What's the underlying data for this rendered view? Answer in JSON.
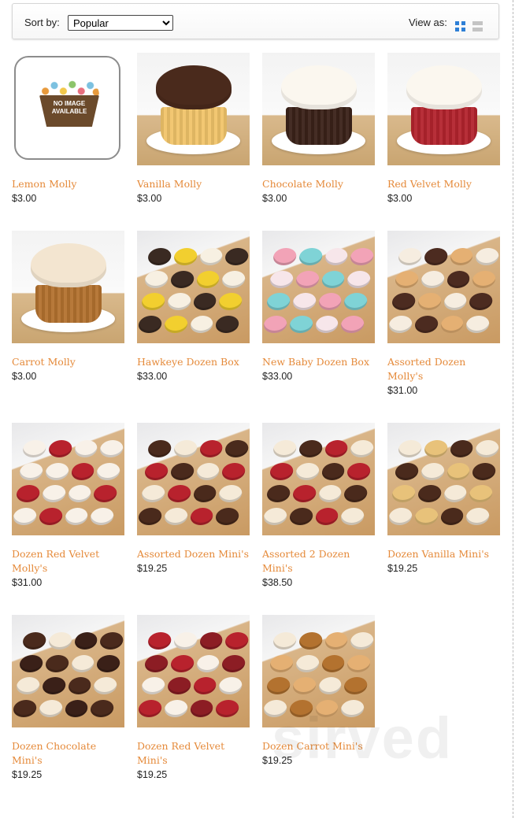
{
  "toolbar": {
    "sort_label": "Sort by:",
    "sort_value": "Popular",
    "view_label": "View as:"
  },
  "colors": {
    "link": "#e58a3a",
    "view_active": "#2e7fd6",
    "view_inactive": "#c4c4c4"
  },
  "products": [
    {
      "name": "Lemon Molly",
      "price": "$3.00",
      "image": "no-image"
    },
    {
      "name": "Vanilla Molly",
      "price": "$3.00",
      "image": "cupcake-chocolate-frosting"
    },
    {
      "name": "Chocolate Molly",
      "price": "$3.00",
      "image": "cupcake-white-frosting"
    },
    {
      "name": "Red Velvet Molly",
      "price": "$3.00",
      "image": "cupcake-red-velvet"
    },
    {
      "name": "Carrot Molly",
      "price": "$3.00",
      "image": "cupcake-carrot"
    },
    {
      "name": "Hawkeye Dozen Box",
      "price": "$33.00",
      "image": "box-black-gold"
    },
    {
      "name": "New Baby Dozen Box",
      "price": "$33.00",
      "image": "box-pink-blue"
    },
    {
      "name": "Assorted Dozen Molly's",
      "price": "$31.00",
      "image": "box-assorted"
    },
    {
      "name": "Dozen Red Velvet Molly's",
      "price": "$31.00",
      "image": "box-red-velvet"
    },
    {
      "name": "Assorted Dozen Mini's",
      "price": "$19.25",
      "image": "box-assorted-mini"
    },
    {
      "name": "Assorted 2 Dozen Mini's",
      "price": "$38.50",
      "image": "box-2-dozen-mini"
    },
    {
      "name": "Dozen Vanilla Mini's",
      "price": "$19.25",
      "image": "box-vanilla-mini"
    },
    {
      "name": "Dozen Chocolate Mini's",
      "price": "$19.25",
      "image": "box-chocolate-mini"
    },
    {
      "name": "Dozen Red Velvet Mini's",
      "price": "$19.25",
      "image": "box-red-velvet-mini"
    },
    {
      "name": "Dozen Carrot Mini's",
      "price": "$19.25",
      "image": "box-carrot-mini"
    }
  ],
  "no_image_text": "NO IMAGE AVAILABLE",
  "watermark": "sirved"
}
